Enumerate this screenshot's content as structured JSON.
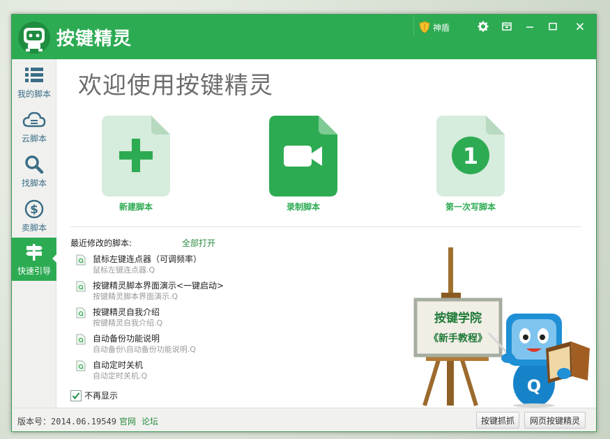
{
  "app": {
    "title": "按键精灵",
    "shield_label": "神盾",
    "brand_color": "#2dab53"
  },
  "sidebar": {
    "items": [
      {
        "label": "我的脚本",
        "icon": "list-icon",
        "active": false
      },
      {
        "label": "云脚本",
        "icon": "cloud-icon",
        "active": false
      },
      {
        "label": "找脚本",
        "icon": "search-icon",
        "active": false
      },
      {
        "label": "卖脚本",
        "icon": "dollar-icon",
        "active": false
      },
      {
        "label": "快速引导",
        "icon": "signpost-icon",
        "active": true
      }
    ]
  },
  "main": {
    "welcome": "欢迎使用按键精灵",
    "actions": [
      {
        "label": "新建脚本",
        "icon": "plus-icon"
      },
      {
        "label": "录制脚本",
        "icon": "video-camera-icon"
      },
      {
        "label": "第一次写脚本",
        "icon": "number-one-icon",
        "badge": "1"
      }
    ],
    "recent_label": "最近修改的脚本:",
    "open_all": "全部打开",
    "recent": [
      {
        "name": "鼠标左键连点器（可调频率）",
        "path": "鼠标左键连点器.Q"
      },
      {
        "name": "按键精灵脚本界面演示<一键启动>",
        "path": "按键精灵脚本界面演示.Q"
      },
      {
        "name": "按键精灵自我介绍",
        "path": "按键精灵自我介绍.Q"
      },
      {
        "name": "自动备份功能说明",
        "path": "自动备份\\自动备份功能说明.Q"
      },
      {
        "name": "自动定时关机",
        "path": "自动定时关机.Q"
      }
    ],
    "no_show_label": "不再显示",
    "no_show_checked": true,
    "illustration": {
      "board_line1": "按键学院",
      "board_line2": "《新手教程》",
      "mascot_letter": "Q"
    }
  },
  "footer": {
    "version": "版本号：2014.06.19549",
    "link_official": "官网",
    "link_forum": "论坛",
    "btn_capture": "按键抓抓",
    "btn_web": "网页按键精灵"
  }
}
